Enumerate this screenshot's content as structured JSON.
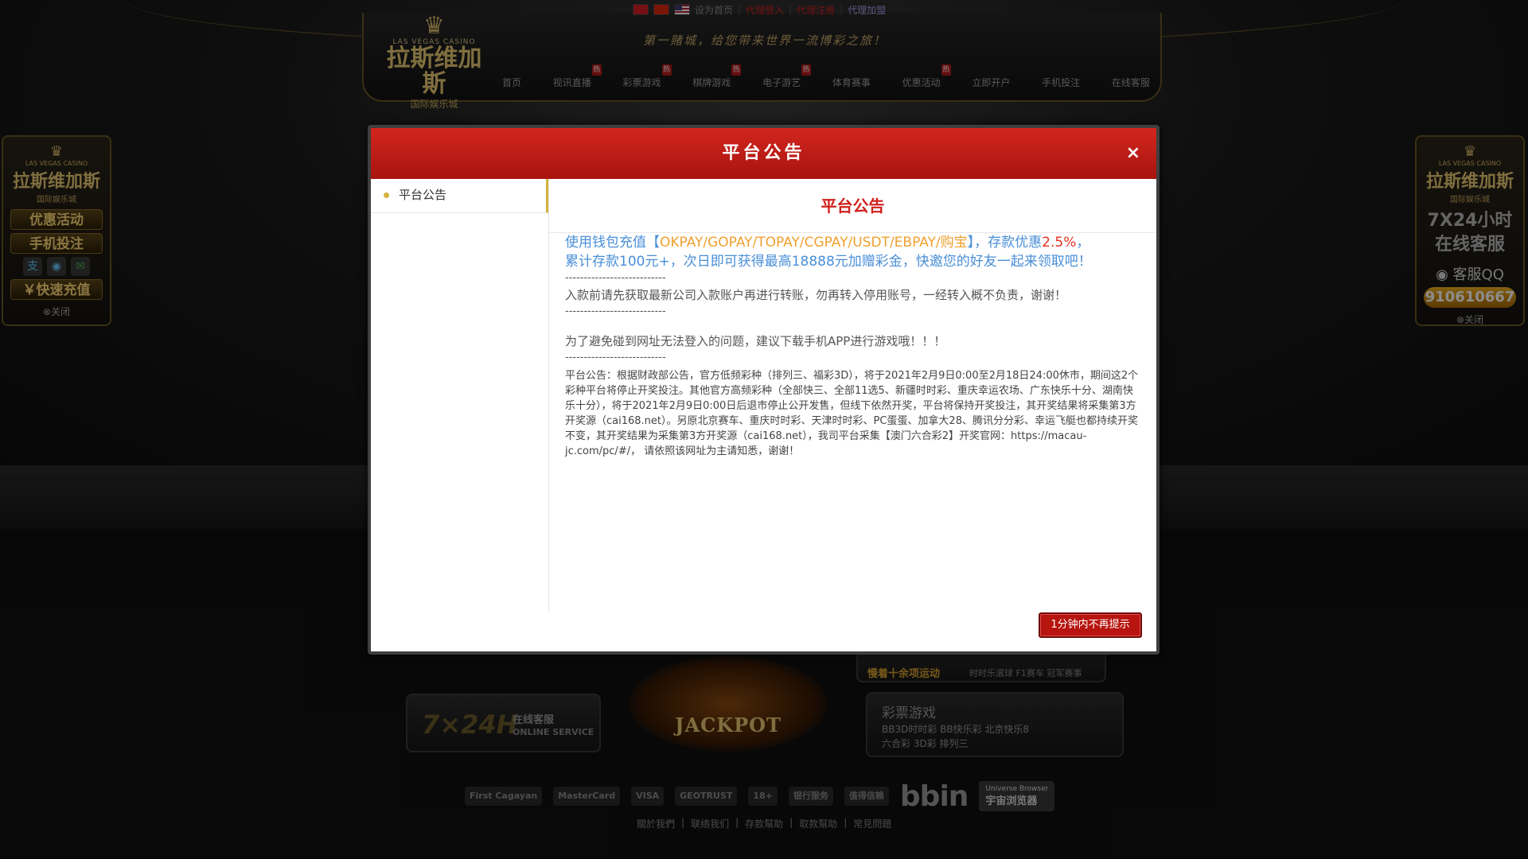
{
  "topbar": {
    "set_home": "设为首页",
    "agent_login": "代理登入",
    "agent_register": "代理注册",
    "agent_join": "代理加盟"
  },
  "logo": {
    "en": "LAS VEGAS CASINO",
    "cn": "拉斯维加斯",
    "sub": "国际娱乐城"
  },
  "slogan": "第一赌城，给您带来世界一流博彩之旅！",
  "nav": [
    {
      "label": "首页",
      "hot": ""
    },
    {
      "label": "视讯直播",
      "hot": "热"
    },
    {
      "label": "彩票游戏",
      "hot": "热"
    },
    {
      "label": "棋牌游戏",
      "hot": "热"
    },
    {
      "label": "电子游艺",
      "hot": "热"
    },
    {
      "label": "体育赛事",
      "hot": ""
    },
    {
      "label": "优惠活动",
      "hot": "热"
    },
    {
      "label": "立即开户",
      "hot": ""
    },
    {
      "label": "手机投注",
      "hot": ""
    },
    {
      "label": "在线客服",
      "hot": ""
    }
  ],
  "left_float": {
    "en": "LAS VEGAS CASINO",
    "cn": "拉斯维加斯",
    "sub": "国际娱乐城",
    "promo": "优惠活动",
    "mobile": "手机投注",
    "recharge": "￥快速充值",
    "close": "⊗关闭"
  },
  "right_float": {
    "en": "LAS VEGAS CASINO",
    "cn": "拉斯维加斯",
    "sub": "国际娱乐城",
    "line1": "7X24小时",
    "line2": "在线客服",
    "qq_label": "客服QQ",
    "qq_number": "910610667",
    "close": "⊗关闭"
  },
  "lower": {
    "service_big": "7×24H",
    "service_cn": "在线客服",
    "service_en": "ONLINE SERVICE",
    "jackpot": "JACKPOT",
    "sport_a": "慢着十余项运动",
    "sport_b": "时时乐滚球  F1赛车  冠军赛事",
    "lottery_title": "彩票游戏",
    "lottery_line1": "BB3D时时彩  BB快乐彩  北京快乐8",
    "lottery_line2": "六合彩  3D彩  排列三"
  },
  "payments": [
    "First Cagayan",
    "MasterCard",
    "VISA",
    "GEOTRUST",
    "18+",
    "银行服务",
    "值得信赖"
  ],
  "bbin": "bbin",
  "browser": {
    "line1": "Universe Browser",
    "line2": "宇宙浏览器"
  },
  "footer_links": [
    "關於我們",
    "联络我们",
    "存款幫助",
    "取款幫助",
    "常見問題"
  ],
  "modal": {
    "title": "平台公告",
    "close": "×",
    "side_item": "平台公告",
    "content_title": "平台公告",
    "promo_a": "使用钱包充值【",
    "promo_pays": "OKPAY/GOPAY/TOPAY/CGPAY/USDT/EBPAY/购宝",
    "promo_b": "】，存款优惠",
    "promo_rate": "2.5%",
    "promo_c": "，",
    "promo_line2": "累计存款100元+，次日即可获得最高18888元加赠彩金，快邀您的好友一起来领取吧！",
    "divider": "---------------------------",
    "notice1": "入款前请先获取最新公司入款账户再进行转账，勿再转入停用账号，一经转入概不负责，谢谢！",
    "notice2": "为了避免碰到网址无法登入的问题，建议下载手机APP进行游戏哦！！！",
    "fine": "平台公告：根据财政部公告，官方低频彩种（排列三、福彩3D），将于2021年2月9日0:00至2月18日24:00休市，期间这2个彩种平台将停止开奖投注。其他官方高频彩种（全部快三、全部11选5、新疆时时彩、重庆幸运农场、广东快乐十分、湖南快乐十分），将于2021年2月9日0:00日后退市停止公开发售，但线下依然开奖，平台将保持开奖投注，其开奖结果将采集第3方开奖源（cai168.net）。另原北京赛车、重庆时时彩、天津时时彩、PC蛋蛋、加拿大28、腾讯分分彩、幸运飞艇也都持续开奖不变，其开奖结果为采集第3方开奖源（cai168.net），我司平台采集【澳门六合彩2】开奖官网：https://macau-jc.com/pc/#/， 请依照该网址为主请知悉，谢谢！",
    "dismiss_button": "1分钟内不再提示"
  }
}
